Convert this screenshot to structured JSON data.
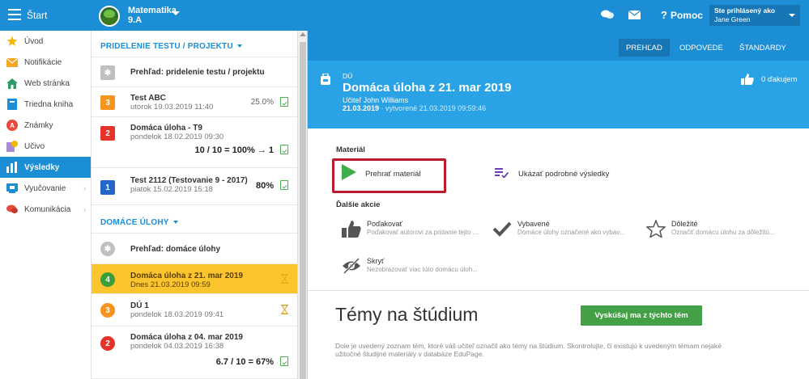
{
  "topbar": {
    "start_label": "Štart",
    "class_name": "Matematika",
    "class_code": "9.A",
    "help_label": "Pomoc",
    "user_caption": "Ste prihlásený ako",
    "user_name": "Jane Green"
  },
  "sidebar": {
    "items": [
      {
        "label": "Úvod",
        "icon": "star-icon",
        "color": "#f5b800"
      },
      {
        "label": "Notifikácie",
        "icon": "envelope-icon",
        "color": "#f5a623"
      },
      {
        "label": "Web stránka",
        "icon": "home-icon",
        "color": "#2a9d6a"
      },
      {
        "label": "Triedna kniha",
        "icon": "book-icon",
        "color": "#1c8ed6"
      },
      {
        "label": "Známky",
        "icon": "grades-icon",
        "color": "#e84b3c"
      },
      {
        "label": "Učivo",
        "icon": "curriculum-icon",
        "color": "#a98bd6"
      },
      {
        "label": "Výsledky",
        "icon": "bar-chart-icon",
        "color": "#ffffff"
      },
      {
        "label": "Vyučovanie",
        "icon": "teaching-icon",
        "color": "#1c8ed6"
      },
      {
        "label": "Komunikácia",
        "icon": "chat-icon",
        "color": "#e84b3c"
      }
    ],
    "active_index": 6
  },
  "tests_section": {
    "header": "PRIDELENIE TESTU / PROJEKTU",
    "overview_label": "Prehľad: pridelenie testu / projektu",
    "items": [
      {
        "num": "3",
        "color": "#f7941d",
        "title": "Test ABC",
        "date": "utorok 19.03.2019 11:40",
        "score": "25.0%"
      },
      {
        "num": "2",
        "color": "#e5332a",
        "title": "Domáca úloha - T9",
        "date": "pondelok 18.02.2019 09:30",
        "score": "10 / 10 = 100% → 1"
      },
      {
        "num": "1",
        "color": "#2566c8",
        "title": "Test 2112 (Testovanie 9 - 2017)",
        "date": "piatok 15.02.2019 15:18",
        "score": "80%"
      }
    ]
  },
  "homework_section": {
    "header": "DOMÁCE ÚLOHY",
    "overview_label": "Prehľad: domáce úlohy",
    "items": [
      {
        "num": "4",
        "color": "#3a9e3a",
        "title": "Domáca úloha z 21. mar 2019",
        "date": "Dnes 21.03.2019 09:59",
        "score": ""
      },
      {
        "num": "3",
        "color": "#f7941d",
        "title": "DÚ 1",
        "date": "pondelok 18.03.2019 09:41",
        "score": ""
      },
      {
        "num": "2",
        "color": "#e5332a",
        "title": "Domáca úloha z 04. mar 2019",
        "date": "pondelok 04.03.2019 16:38",
        "score": "6.7 / 10 = 67%"
      }
    ]
  },
  "right_nav": {
    "tabs": [
      "PREHĽAD",
      "ODPOVEDE",
      "ŠTANDARDY"
    ],
    "active_index": 0
  },
  "homework": {
    "kind": "DÚ",
    "title": "Domáca úloha z 21. mar 2019",
    "teacher": "Učiteľ John Williams",
    "date": "21.03.2019",
    "created": "· vytvorené 21.03.2019 09:59:46",
    "thanks": "0 ďakujem"
  },
  "material": {
    "header": "Materiál",
    "play_label": "Prehrať materiál",
    "results_label": "Ukázať podrobné výsledky"
  },
  "actions": {
    "header": "Ďalšie akcie",
    "items": [
      {
        "title": "Poďakovať",
        "desc": "Poďakovať autorovi za pridanie tejto ..."
      },
      {
        "title": "Vybavené",
        "desc": "Domáce úlohy označené ako vybav..."
      },
      {
        "title": "Dôležité",
        "desc": "Označiť domácu úlohu za dôležitú..."
      },
      {
        "title": "Skryť",
        "desc": "Nezobrazovať viac túto domácu úloh..."
      }
    ]
  },
  "topics": {
    "title": "Témy na štúdium",
    "button": "Vyskúšaj ma z týchto tém",
    "description": "Dole je uvedený zoznam tém, ktoré váš učiteľ označil ako témy na štúdium. Skontrolujte, či existujú k uvedeným témam nejaké užitočné študijné materiály v databáze EduPage."
  }
}
